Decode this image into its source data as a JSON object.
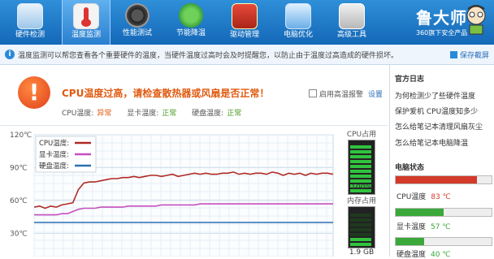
{
  "toolbar": {
    "items": [
      {
        "label": "硬件检测",
        "icon": "monitor-magnifier-icon"
      },
      {
        "label": "温度监测",
        "icon": "thermometer-icon"
      },
      {
        "label": "性能测试",
        "icon": "speedometer-icon"
      },
      {
        "label": "节能降温",
        "icon": "clover-leaf-icon"
      },
      {
        "label": "驱动管理",
        "icon": "toolbox-icon"
      },
      {
        "label": "电脑优化",
        "icon": "broom-monitor-icon"
      },
      {
        "label": "高级工具",
        "icon": "tool-box-icon"
      }
    ],
    "active_index": 1
  },
  "brand": {
    "name": "鲁大师",
    "subtitle": "360旗下安全产品"
  },
  "infobar": {
    "text": "温度监测可以帮您查看各个重要硬件的温度，当硬件温度过高时会及时提醒您，以防止由于温度过高造成的硬件损坏。",
    "save_label": "保存截屏"
  },
  "alert": {
    "headline": "CPU温度过高，请检查散热器或风扇是否正常！",
    "status": [
      {
        "label": "CPU温度:",
        "value": "异常",
        "state": "bad"
      },
      {
        "label": "显卡温度:",
        "value": "正常",
        "state": "ok"
      },
      {
        "label": "硬盘温度:",
        "value": "正常",
        "state": "ok"
      }
    ],
    "alarm_label": "启用高温报警",
    "settings_label": "设置"
  },
  "chart_data": {
    "type": "line",
    "y_ticks": [
      "120℃",
      "90℃",
      "60℃",
      "30℃"
    ],
    "ylim": [
      30,
      120
    ],
    "legend": [
      {
        "name": "CPU温度:",
        "color": "#b02a24"
      },
      {
        "name": "显卡温度:",
        "color": "#c54fc0"
      },
      {
        "name": "硬盘温度:",
        "color": "#2d6fb0"
      }
    ],
    "series": [
      {
        "name": "CPU温度:",
        "color": "#b02a24",
        "values": [
          54,
          55,
          53,
          55,
          54,
          56,
          57,
          58,
          70,
          76,
          77,
          77,
          78,
          79,
          80,
          80,
          81,
          81,
          82,
          81,
          82,
          83,
          83,
          82,
          83,
          84,
          82,
          83,
          84,
          85,
          84,
          85,
          84,
          84,
          85,
          85,
          86,
          84,
          85,
          84,
          85,
          85,
          84,
          86,
          85,
          83,
          85,
          84,
          85,
          83,
          85,
          84,
          85,
          85,
          84
        ]
      },
      {
        "name": "显卡温度:",
        "color": "#c54fc0",
        "values": [
          47,
          47,
          47,
          47,
          47,
          48,
          48,
          50,
          52,
          53,
          53,
          53,
          54,
          54,
          54,
          54,
          54,
          55,
          55,
          55,
          55,
          55,
          55,
          56,
          56,
          56,
          56,
          56,
          56,
          56,
          57,
          57,
          57,
          57,
          57,
          57,
          57,
          57,
          57,
          57,
          57,
          57,
          57,
          57,
          57,
          57,
          57,
          57,
          57,
          57,
          57,
          57,
          57,
          57,
          57
        ]
      },
      {
        "name": "硬盘温度:",
        "color": "#2d6fb0",
        "values": [
          40,
          40,
          40,
          40,
          40,
          40,
          40,
          40,
          40,
          40,
          40,
          40,
          40,
          40,
          40,
          40,
          40,
          40,
          40,
          40,
          40,
          40,
          40,
          40,
          40,
          40,
          40,
          40,
          40,
          40,
          40,
          40,
          40,
          40,
          40,
          40,
          40,
          40,
          40,
          40,
          40,
          40,
          40,
          40,
          40,
          40,
          40,
          40,
          40,
          40,
          40,
          40,
          40,
          40,
          40
        ]
      }
    ]
  },
  "gauges": [
    {
      "title": "CPU占用",
      "value_label": "100%",
      "level": 1.0
    },
    {
      "title": "内存占用",
      "value_label": "1.9 GB",
      "level": 0.25
    }
  ],
  "rightpanel": {
    "log_title": "官方日志",
    "log_links": [
      "为何检测少了些硬件温度",
      "保护爱机 CPU温度知多少",
      "怎么给笔记本清理风扇灰尘",
      "怎么给笔记本电脑降温"
    ],
    "status_title": "电脑状态",
    "meters": [
      {
        "label": "CPU温度",
        "value": "83 ℃",
        "color": "#d33a2a",
        "value_color": "#d33a2a",
        "level": 0.85
      },
      {
        "label": "显卡温度",
        "value": "57 ℃",
        "color": "#3aa83a",
        "value_color": "#3aa83a",
        "level": 0.5
      },
      {
        "label": "硬盘温度",
        "value": "40 ℃",
        "color": "#3aa83a",
        "value_color": "#3aa83a",
        "level": 0.3
      }
    ]
  }
}
